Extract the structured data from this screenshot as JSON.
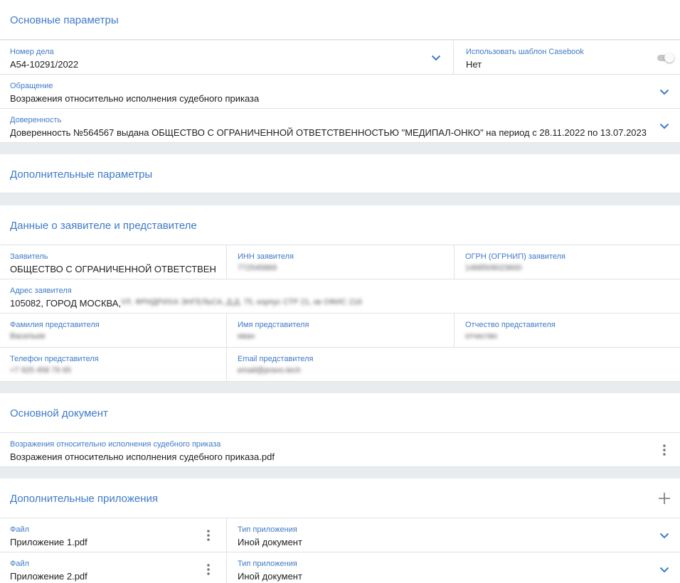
{
  "main_params": {
    "title": "Основные параметры",
    "case_number": {
      "label": "Номер дела",
      "value": "А54-10291/2022"
    },
    "casebook": {
      "label": "Использовать шаблон Casebook",
      "value": "Нет"
    },
    "appeal": {
      "label": "Обращение",
      "value": "Возражения относительно исполнения судебного приказа"
    },
    "power_of_attorney": {
      "label": "Доверенность",
      "value": "Доверенность №564567 выдана ОБЩЕСТВО С ОГРАНИЧЕННОЙ ОТВЕТСТВЕННОСТЬЮ \"МЕДИПАЛ-ОНКО\" на период с 28.11.2022 по 13.07.2023"
    }
  },
  "extra_params": {
    "title": "Дополнительные параметры"
  },
  "applicant": {
    "title": "Данные о заявителе и представителе",
    "name": {
      "label": "Заявитель",
      "value": "ОБЩЕСТВО С ОГРАНИЧЕННОЙ ОТВЕТСТВЕН…"
    },
    "inn": {
      "label": "ИНН заявителя",
      "value": "772545869"
    },
    "ogrn": {
      "label": "ОГРН (ОГРНИП) заявителя",
      "value": "1468509023600"
    },
    "address": {
      "label": "Адрес заявителя",
      "value": "105082, ГОРОД МОСКВА,",
      "value_hidden": "УЛ. ФРИДРИХА ЭНГЕЛЬСА, Д.Д. 75, корпус СТР 21, кв ОФИС 216"
    },
    "rep_surname": {
      "label": "Фамилия представителя",
      "value": "Васильев"
    },
    "rep_name": {
      "label": "Имя представителя",
      "value": "иван"
    },
    "rep_patronymic": {
      "label": "Отчество представителя",
      "value": "отчество"
    },
    "rep_phone": {
      "label": "Телефон представителя",
      "value": "+7 925 458 79 65"
    },
    "rep_email": {
      "label": "Email представителя",
      "value": "email@pravo.tech"
    }
  },
  "main_doc": {
    "title": "Основной документ",
    "label": "Возражения относительно исполнения судебного приказа",
    "value": "Возражения относительно исполнения судебного приказа.pdf"
  },
  "attachments": {
    "title": "Дополнительные приложения",
    "items": [
      {
        "file_label": "Файл",
        "file_value": "Приложение 1.pdf",
        "type_label": "Тип приложения",
        "type_value": "Иной документ"
      },
      {
        "file_label": "Файл",
        "file_value": "Приложение 2.pdf",
        "type_label": "Тип приложения",
        "type_value": "Иной документ"
      }
    ]
  },
  "colors": {
    "accent": "#3f7ac8",
    "divider": "#dfe2e4",
    "gap": "#e9ecee",
    "text": "#212121"
  },
  "icons": [
    "chevron-down-icon",
    "more-vert-icon",
    "plus-icon",
    "toggle-switch"
  ]
}
